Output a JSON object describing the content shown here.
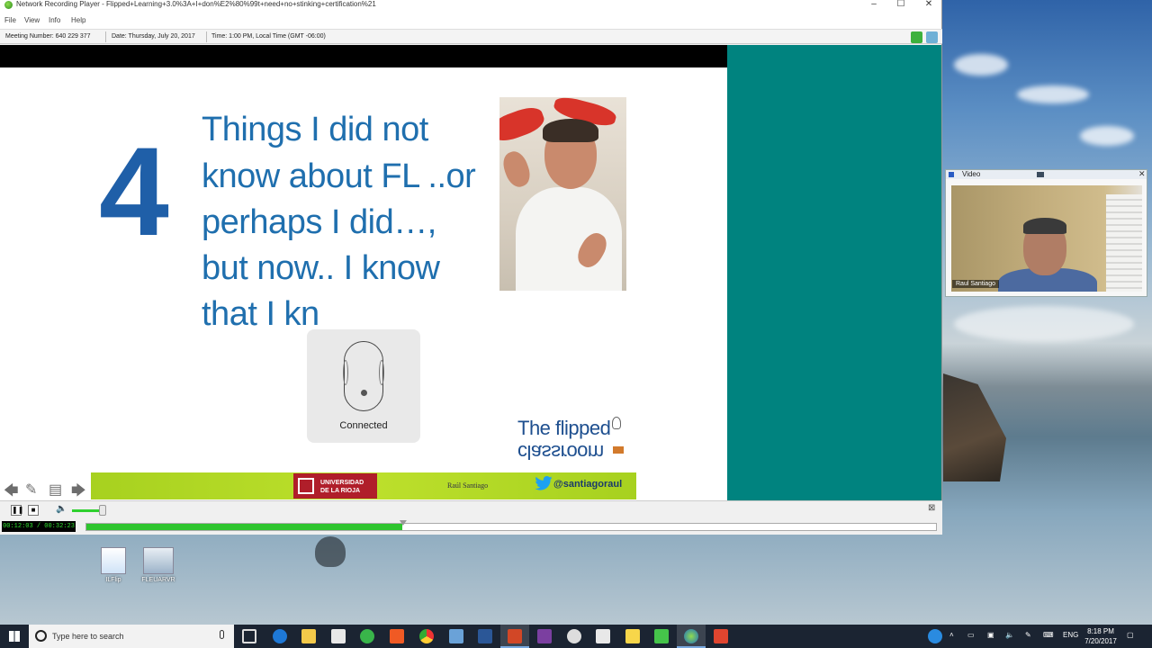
{
  "window": {
    "title": "Network Recording Player - Flipped+Learning+3.0%3A+I+don%E2%80%99t+need+no+stinking+certification%21",
    "controls": {
      "minimize": "–",
      "maximize": "☐",
      "close": "✕"
    }
  },
  "menu": [
    "File",
    "View",
    "Info",
    "Help"
  ],
  "info_bar": {
    "meeting": "Meeting Number: 640 229 377",
    "date": "Date: Thursday, July 20, 2017",
    "time": "Time: 1:00 PM, Local Time (GMT -06:00)"
  },
  "slide": {
    "number": "4",
    "lines": [
      "Things I did not",
      "know about FL ..or",
      "perhaps I did…,",
      "but now.. I know",
      "that I kn"
    ],
    "overlay_status": "Connected",
    "logo_top": "The flipped",
    "logo_bottom": "classroom",
    "university_line1": "UNIVERSIDAD",
    "university_line2": "DE LA RIOJA",
    "presenter": "Raúl Santiago",
    "twitter_handle": "@santiagoraul"
  },
  "slide_nav": {
    "prev": "🡄",
    "pen": "✎",
    "notes": "▤",
    "next": "🡆"
  },
  "player": {
    "pause": "❚❚",
    "stop": "■",
    "volume_icon": "🔈",
    "volume": 0.9,
    "timecode": "00:12:03 / 00:32:23",
    "progress": 0.372
  },
  "video_panel": {
    "title": "Video",
    "name_tag": "Raul Santiago"
  },
  "desktop_icons": [
    {
      "label": "ILFlip"
    },
    {
      "label": "FLEUARVR"
    }
  ],
  "taskbar": {
    "search_placeholder": "Type here to search",
    "language": "ENG",
    "time": "8:18 PM",
    "date": "7/20/2017"
  },
  "colors": {
    "slide_blue": "#1f6fae",
    "teal_panel": "#00837f",
    "progress_green": "#2ec52e",
    "footer_green": "#a7d11f",
    "university_red": "#b01e2a"
  }
}
